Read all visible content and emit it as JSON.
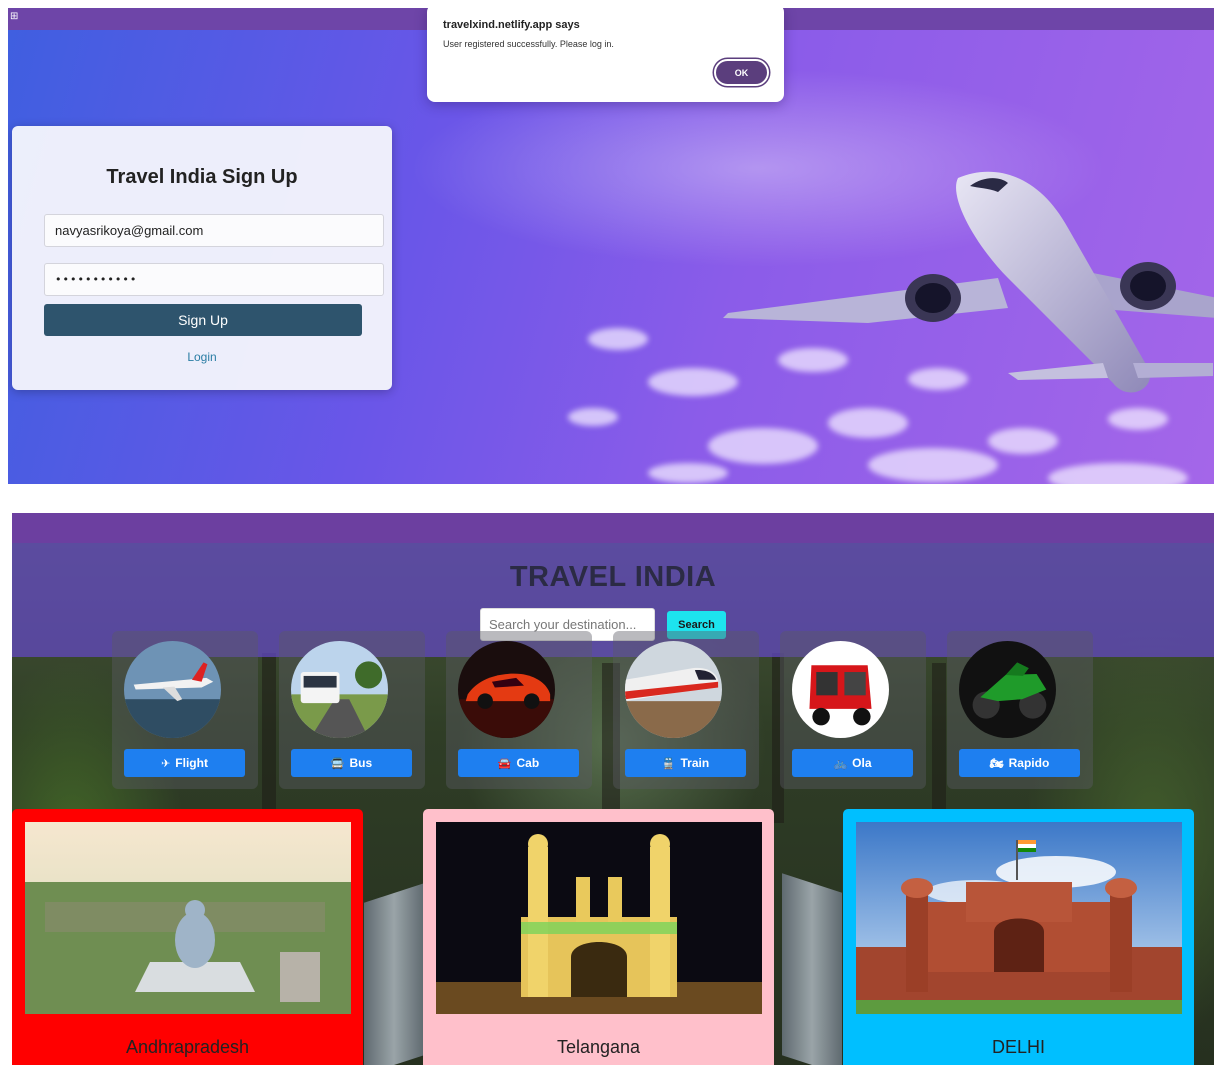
{
  "signup_page": {
    "browser": {
      "apps_icon": "apps-grid-icon"
    },
    "alert": {
      "origin": "travelxind.netlify.app says",
      "message": "User registered successfully. Please log in.",
      "ok_label": "OK"
    },
    "form": {
      "title": "Travel India Sign Up",
      "email_value": "navyasrikoya@gmail.com",
      "password_value": "•••••••••••",
      "submit_label": "Sign Up",
      "login_link": "Login"
    }
  },
  "home_page": {
    "title": "TRAVEL INDIA",
    "search": {
      "placeholder": "Search your destination...",
      "button_label": "Search"
    },
    "transport": [
      {
        "label": "Flight",
        "icon": "plane-icon"
      },
      {
        "label": "Bus",
        "icon": "bus-icon"
      },
      {
        "label": "Cab",
        "icon": "car-icon"
      },
      {
        "label": "Train",
        "icon": "train-icon"
      },
      {
        "label": "Ola",
        "icon": "bicycle-icon"
      },
      {
        "label": "Rapido",
        "icon": "motorcycle-icon"
      }
    ],
    "states": [
      {
        "name": "Andhrapradesh",
        "color": "#ff0000"
      },
      {
        "name": "Telangana",
        "color": "#ffc0cb"
      },
      {
        "name": "DELHI",
        "color": "#00bfff"
      }
    ]
  },
  "colors": {
    "browser_bar": "#6e45a8",
    "signup_button": "#2e546d",
    "alert_ok": "#5b3e7d",
    "search_button": "#1de4ee",
    "transport_button": "#1e7ff0"
  }
}
